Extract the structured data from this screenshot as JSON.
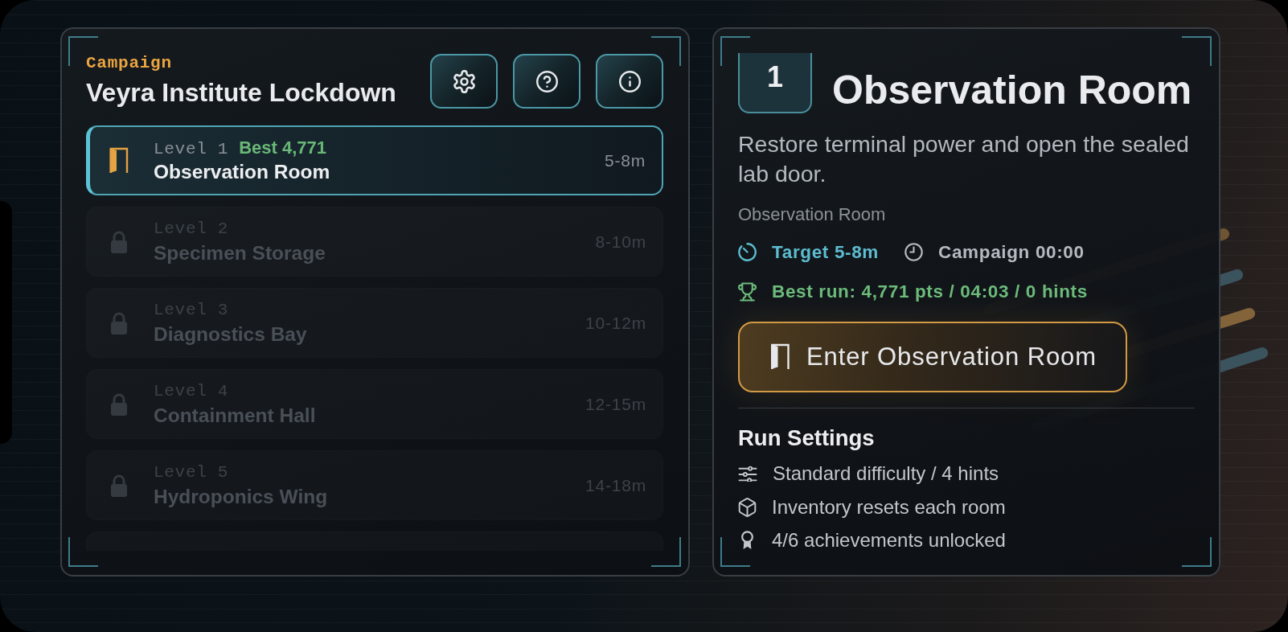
{
  "campaign": {
    "kicker": "Campaign",
    "title": "Veyra Institute Lockdown",
    "levels": [
      {
        "label": "Level 1",
        "best": "Best 4,771",
        "name": "Observation Room",
        "duration": "5-8m",
        "locked": false,
        "selected": true
      },
      {
        "label": "Level 2",
        "name": "Specimen Storage",
        "duration": "8-10m",
        "locked": true,
        "selected": false
      },
      {
        "label": "Level 3",
        "name": "Diagnostics Bay",
        "duration": "10-12m",
        "locked": true,
        "selected": false
      },
      {
        "label": "Level 4",
        "name": "Containment Hall",
        "duration": "12-15m",
        "locked": true,
        "selected": false
      },
      {
        "label": "Level 5",
        "name": "Hydroponics Wing",
        "duration": "14-18m",
        "locked": true,
        "selected": false
      },
      {
        "locked": true,
        "selected": false
      }
    ]
  },
  "detail": {
    "number": "1",
    "title": "Observation Room",
    "description": "Restore terminal power and open the sealed lab door.",
    "location": "Observation Room",
    "target": "Target 5-8m",
    "campaign_time": "Campaign 00:00",
    "best_run": "Best run: 4,771 pts / 04:03 / 0 hints",
    "enter_button": "Enter Observation Room",
    "settings_title": "Run Settings",
    "settings": [
      {
        "kind": "difficulty",
        "text": "Standard difficulty / 4 hints"
      },
      {
        "kind": "inventory",
        "text": "Inventory resets each room"
      },
      {
        "kind": "achievements",
        "text": "4/6 achievements unlocked"
      }
    ]
  }
}
